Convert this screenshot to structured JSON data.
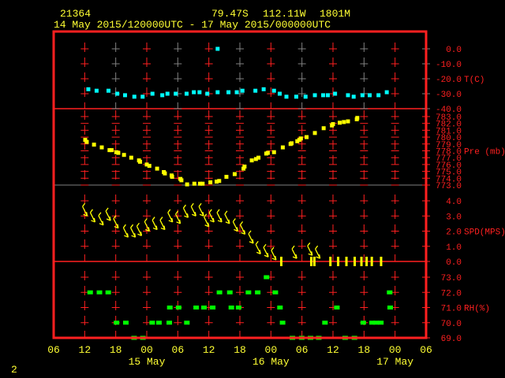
{
  "header": {
    "station": "21364",
    "lat": "79.47S",
    "lon": "112.11W",
    "elev": "1801M",
    "range": "14 May 2015/120000UTC - 17 May 2015/000000UTC"
  },
  "footer": {
    "page": "2"
  },
  "colors": {
    "frame": "#ff2020",
    "temp": "#00ffff",
    "pres": "#ffff00",
    "wind": "#ffff00",
    "rh": "#00ff00",
    "grid_gray": "#808080"
  },
  "chart_data": {
    "type": "scatter",
    "x_unit": "hours since 14 May 2015 06 UTC",
    "xlim": [
      0,
      72
    ],
    "x_ticks": [
      "06",
      "12",
      "18",
      "00",
      "06",
      "12",
      "18",
      "00",
      "06",
      "12",
      "18",
      "00",
      "06"
    ],
    "date_labels": [
      {
        "hour": 18,
        "label": "15 May"
      },
      {
        "hour": 42,
        "label": "16 May"
      },
      {
        "hour": 66,
        "label": "17 May"
      }
    ],
    "panels": [
      {
        "name": "temperature",
        "label": "T(C)",
        "ylim": [
          -40,
          0
        ],
        "ticks": [
          "0.0",
          "-10.0",
          "-20.0",
          "-30.0",
          "-40.0"
        ],
        "tick_values": [
          0,
          -10,
          -20,
          -30,
          -40
        ],
        "points": [
          [
            6.7,
            -27
          ],
          [
            8.3,
            -28
          ],
          [
            10.6,
            -28
          ],
          [
            12.3,
            -30
          ],
          [
            13.8,
            -31
          ],
          [
            15.6,
            -32
          ],
          [
            17.2,
            -32
          ],
          [
            19.1,
            -30
          ],
          [
            21,
            -31
          ],
          [
            22,
            -30
          ],
          [
            23.6,
            -30
          ],
          [
            25.7,
            -30
          ],
          [
            27.1,
            -29
          ],
          [
            28.2,
            -29
          ],
          [
            29.7,
            -30
          ],
          [
            31.7,
            -29
          ],
          [
            31.7,
            0
          ],
          [
            33.8,
            -29
          ],
          [
            35.4,
            -29
          ],
          [
            36.5,
            -28
          ],
          [
            39,
            -28
          ],
          [
            40.6,
            -27
          ],
          [
            42.6,
            -28
          ],
          [
            43.7,
            -30
          ],
          [
            45,
            -32
          ],
          [
            46.9,
            -32
          ],
          [
            48.7,
            -32
          ],
          [
            50.5,
            -31
          ],
          [
            52.1,
            -31
          ],
          [
            53,
            -31
          ],
          [
            54.4,
            -30
          ],
          [
            56.9,
            -31
          ],
          [
            58,
            -32
          ],
          [
            59.7,
            -31
          ],
          [
            61.1,
            -31
          ],
          [
            62.8,
            -31
          ],
          [
            64.4,
            -29
          ]
        ]
      },
      {
        "name": "pressure",
        "label": "Pre (mb)",
        "ylim": [
          773,
          783
        ],
        "ticks": [
          "783.0",
          "782.0",
          "781.0",
          "780.0",
          "779.0",
          "778.0",
          "777.0",
          "776.0",
          "775.0",
          "774.0",
          "773.0"
        ],
        "tick_values": [
          783,
          782,
          781,
          780,
          779,
          778,
          777,
          776,
          775,
          774,
          773
        ],
        "points": [
          [
            6.1,
            779.6
          ],
          [
            6.4,
            779.3
          ],
          [
            7.8,
            778.9
          ],
          [
            9.3,
            778.5
          ],
          [
            10.8,
            778.1
          ],
          [
            11.2,
            778.1
          ],
          [
            12.1,
            777.8
          ],
          [
            12.5,
            777.7
          ],
          [
            13.6,
            777.4
          ],
          [
            15,
            777
          ],
          [
            16.5,
            776.6
          ],
          [
            16.7,
            776.4
          ],
          [
            18,
            776
          ],
          [
            18.5,
            775.8
          ],
          [
            20,
            775.4
          ],
          [
            21.3,
            774.9
          ],
          [
            21.5,
            774.7
          ],
          [
            22.8,
            774.4
          ],
          [
            22.9,
            774.2
          ],
          [
            24.5,
            773.9
          ],
          [
            24.7,
            773.7
          ],
          [
            25.8,
            773.1
          ],
          [
            27.2,
            773.2
          ],
          [
            28.3,
            773.2
          ],
          [
            28.8,
            773.2
          ],
          [
            30.3,
            773.4
          ],
          [
            31.5,
            773.5
          ],
          [
            32,
            773.6
          ],
          [
            33.4,
            774.2
          ],
          [
            35,
            774.6
          ],
          [
            36.7,
            775.4
          ],
          [
            36.9,
            775.7
          ],
          [
            38.3,
            776.6
          ],
          [
            39.1,
            776.8
          ],
          [
            39.6,
            777
          ],
          [
            41.1,
            777.6
          ],
          [
            41.4,
            777.7
          ],
          [
            42.6,
            777.8
          ],
          [
            44.3,
            778.5
          ],
          [
            45.8,
            779
          ],
          [
            46,
            779.1
          ],
          [
            47.1,
            779.4
          ],
          [
            47.5,
            779.6
          ],
          [
            47.8,
            779.8
          ],
          [
            48.9,
            780
          ],
          [
            50.5,
            780.6
          ],
          [
            52.2,
            781.3
          ],
          [
            53.8,
            781.7
          ],
          [
            54,
            781.9
          ],
          [
            55.3,
            782.1
          ],
          [
            56.1,
            782.2
          ],
          [
            56.9,
            782.3
          ],
          [
            58.6,
            782.6
          ],
          [
            58.7,
            782.8
          ]
        ]
      },
      {
        "name": "wind_speed",
        "label": "SPD(MPS)",
        "ylim": [
          0,
          4
        ],
        "ticks": [
          "4.0",
          "3.0",
          "2.0",
          "1.0",
          "0.0"
        ],
        "tick_values": [
          4,
          3,
          2,
          1,
          0
        ],
        "points": [
          [
            6.5,
            3.0
          ],
          [
            8,
            2.6
          ],
          [
            9.6,
            2.4
          ],
          [
            11,
            2.7
          ],
          [
            12.5,
            2.2
          ],
          [
            14.4,
            1.6
          ],
          [
            15.8,
            1.6
          ],
          [
            17,
            1.7
          ],
          [
            18.5,
            2.0
          ],
          [
            20,
            2.1
          ],
          [
            21.5,
            2.1
          ],
          [
            23,
            2.6
          ],
          [
            24.5,
            2.5
          ],
          [
            26,
            2.9
          ],
          [
            27.5,
            3.0
          ],
          [
            29,
            3.0
          ],
          [
            30,
            2.3
          ],
          [
            31,
            2.6
          ],
          [
            32.5,
            2.6
          ],
          [
            34,
            2.5
          ],
          [
            35.6,
            2.0
          ],
          [
            37,
            1.8
          ],
          [
            38.6,
            1.2
          ],
          [
            40,
            0.5
          ],
          [
            41.5,
            0.3
          ],
          [
            43,
            0.1
          ],
          [
            47,
            0.2
          ],
          [
            50,
            0.4
          ],
          [
            51.5,
            0.2
          ]
        ],
        "calm": [
          44,
          49.8,
          50.4,
          53.5,
          55,
          56.6,
          58.2,
          59.5,
          60.5,
          61.5,
          63.3
        ]
      },
      {
        "name": "relative_humidity",
        "label": "RH(%)",
        "ylim": [
          69,
          73
        ],
        "ticks": [
          "73.0",
          "72.0",
          "71.0",
          "70.0",
          "69.0"
        ],
        "tick_values": [
          73,
          72,
          71,
          70,
          69
        ],
        "points": [
          [
            6.9,
            72
          ],
          [
            8.7,
            72
          ],
          [
            10.4,
            72
          ],
          [
            31.9,
            72
          ],
          [
            33.9,
            72
          ],
          [
            37.5,
            72
          ],
          [
            39.3,
            72
          ],
          [
            42.7,
            72
          ],
          [
            64.8,
            72
          ],
          [
            41,
            73
          ],
          [
            22.3,
            71
          ],
          [
            24,
            71
          ],
          [
            27.4,
            71
          ],
          [
            28.9,
            71
          ],
          [
            30.6,
            71
          ],
          [
            34.2,
            71
          ],
          [
            35.6,
            71
          ],
          [
            43.6,
            71
          ],
          [
            54.6,
            71
          ],
          [
            64.9,
            71
          ],
          [
            12,
            70
          ],
          [
            13.8,
            70
          ],
          [
            18.9,
            70
          ],
          [
            20.2,
            70
          ],
          [
            22.2,
            70
          ],
          [
            25.6,
            70
          ],
          [
            44.1,
            70
          ],
          [
            52.3,
            70
          ],
          [
            59.7,
            70
          ],
          [
            61.4,
            70
          ],
          [
            62.2,
            70
          ],
          [
            63.1,
            70
          ],
          [
            15.4,
            69
          ],
          [
            17.1,
            69
          ],
          [
            46,
            69
          ],
          [
            47.8,
            69
          ],
          [
            49.5,
            69
          ],
          [
            51.1,
            69
          ],
          [
            56.2,
            69
          ],
          [
            58,
            69
          ]
        ]
      }
    ]
  }
}
